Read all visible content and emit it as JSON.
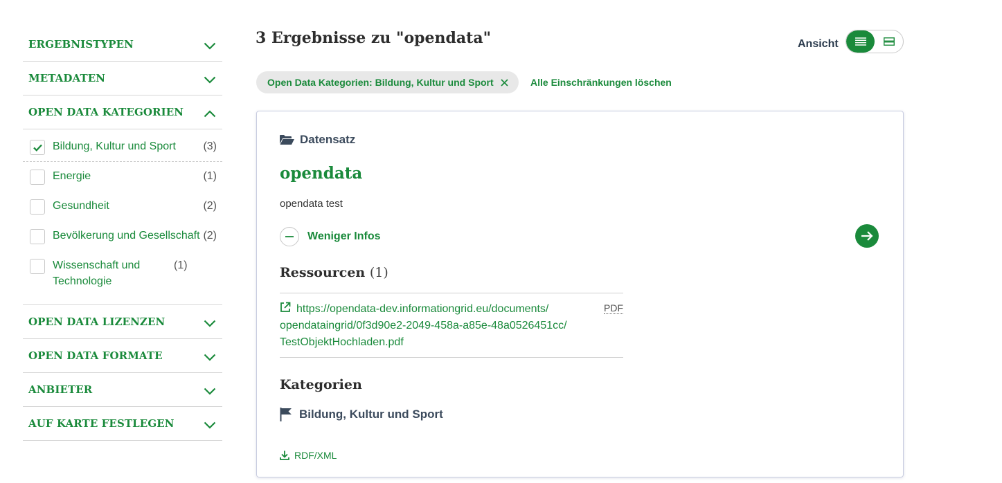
{
  "sidebar": {
    "facets": [
      {
        "title": "ERGEBNISTYPEN",
        "expanded": false
      },
      {
        "title": "METADATEN",
        "expanded": false
      },
      {
        "title": "OPEN DATA KATEGORIEN",
        "expanded": true
      },
      {
        "title": "OPEN DATA LIZENZEN",
        "expanded": false
      },
      {
        "title": "OPEN DATA FORMATE",
        "expanded": false
      },
      {
        "title": "ANBIETER",
        "expanded": false
      },
      {
        "title": "AUF KARTE FESTLEGEN",
        "expanded": false
      }
    ],
    "categories": [
      {
        "label": "Bildung, Kultur und Sport",
        "count": "(3)",
        "checked": true
      },
      {
        "label": "Energie",
        "count": "(1)",
        "checked": false
      },
      {
        "label": "Gesundheit",
        "count": "(2)",
        "checked": false
      },
      {
        "label": "Bevölkerung und Gesellschaft",
        "count": "(2)",
        "checked": false
      },
      {
        "label": "Wissenschaft und Technologie",
        "count": "(1)",
        "checked": false
      }
    ]
  },
  "header": {
    "results_title": "3 Ergebnisse zu \"opendata\"",
    "view_label": "Ansicht"
  },
  "filters": {
    "active_chip": "Open Data Kategorien: Bildung, Kultur und Sport",
    "clear_all": "Alle Einschränkungen löschen"
  },
  "result": {
    "type_label": "Datensatz",
    "title": "opendata",
    "description": "opendata test",
    "less_info": "Weniger Infos",
    "resources_title": "Ressourcen",
    "resources_count": "(1)",
    "resource_url": "https://opendata-dev.informationgrid.eu/documents/opendataingrid/0f3d90e2-2049-458a-a85e-48a0526451cc/TestObjektHochladen.pdf",
    "resource_url_line1": "https://opendata-dev.informationgrid.eu/documents/",
    "resource_url_line2": "opendataingrid/0f3d90e2-2049-458a-a85e-48a0526451cc/",
    "resource_url_line3": "TestObjektHochladen.pdf",
    "resource_format": "PDF",
    "categories_title": "Kategorien",
    "category": "Bildung, Kultur und Sport",
    "download_label": "RDF/XML"
  },
  "colors": {
    "accent": "#1a8a3b",
    "text_dark": "#2d2d2d",
    "slate": "#3b4a5c"
  }
}
